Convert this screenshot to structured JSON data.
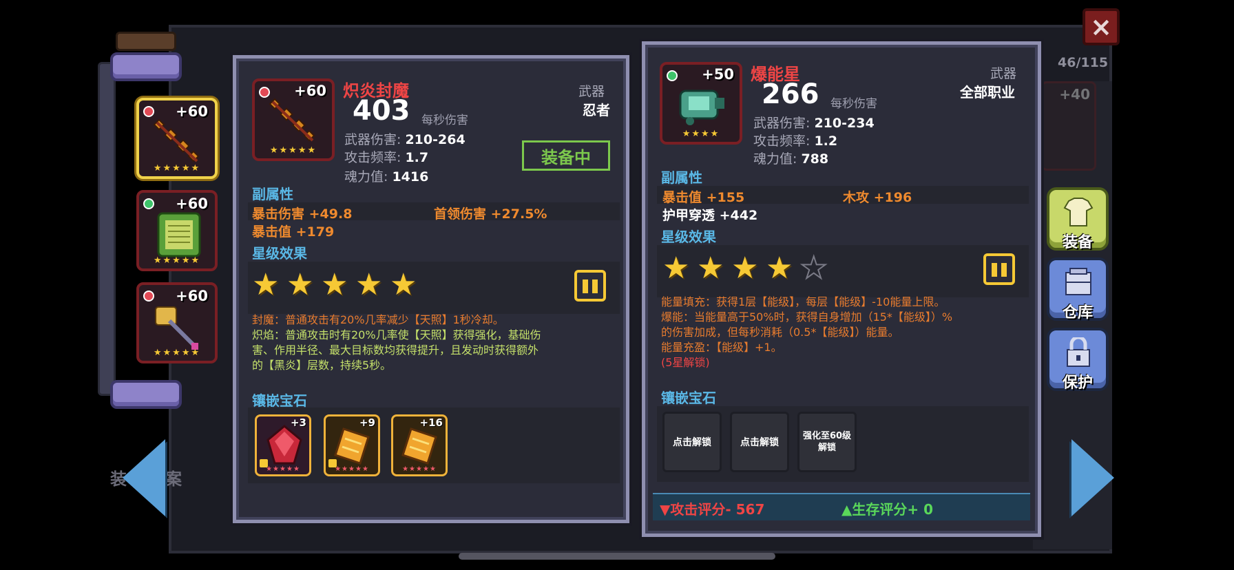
{
  "counter": "46/115",
  "close_icon": "×",
  "ghost_left": "装",
  "ghost_left2": "案",
  "list_items": [
    {
      "plus": "+60",
      "stars": "★★★★★"
    },
    {
      "plus": "+60",
      "stars": "★★★★★"
    },
    {
      "plus": "+60",
      "stars": "★★★★★"
    }
  ],
  "bg_item_plus": "+40",
  "left": {
    "plus": "+60",
    "stars": "★★★★★",
    "name": "炽炎封魔",
    "dps": "403",
    "dps_label": "每秒伤害",
    "type": "武器",
    "class": "忍者",
    "weapon_damage_label": "武器伤害:",
    "weapon_damage": "210-264",
    "attack_rate_label": "攻击频率:",
    "attack_rate": "1.7",
    "soul_label": "魂力值:",
    "soul": "1416",
    "equipped": "装备中",
    "sub_attr_title": "副属性",
    "sub_attrs": [
      "暴击伤害 +49.8",
      "首领伤害 +27.5%",
      "暴击值 +179"
    ],
    "star_title": "星级效果",
    "star_count": 5,
    "effect_1": "封魔：普通攻击有20%几率减少【天照】1秒冷却。",
    "effect_2": "炽焰：普通攻击时有20%几率使【天照】获得强化，基础伤",
    "effect_3": "害、作用半径、最大目标数均获得提升，且发动时获得额外",
    "effect_4": "的【黑炎】层数，持续5秒。",
    "gem_title": "镶嵌宝石",
    "gems": [
      {
        "level": "+3",
        "stars": "★★★★★"
      },
      {
        "level": "+9",
        "stars": "★★★★★"
      },
      {
        "level": "+16",
        "stars": "★★★★★"
      }
    ]
  },
  "right": {
    "plus": "+50",
    "stars": "★★★★",
    "name": "爆能星",
    "dps": "266",
    "dps_label": "每秒伤害",
    "type": "武器",
    "class": "全部职业",
    "weapon_damage_label": "武器伤害:",
    "weapon_damage": "210-234",
    "attack_rate_label": "攻击频率:",
    "attack_rate": "1.2",
    "soul_label": "魂力值:",
    "soul": "788",
    "sub_attr_title": "副属性",
    "sub_attrs": [
      "暴击值 +155",
      "木攻 +196",
      "护甲穿透 +442"
    ],
    "star_title": "星级效果",
    "star_count": 4,
    "star_max": 5,
    "effect_1": "能量填充：获得1层【能级】，每层【能级】-10能量上限。",
    "effect_2": "爆能：当能量高于50%时，获得自身增加（15*【能级】）%",
    "effect_3": "的伤害加成，但每秒消耗（0.5*【能级】）能量。",
    "effect_4": "能量充盈：【能级】+1。",
    "effect_5": "(5星解锁)",
    "gem_title": "镶嵌宝石",
    "gem_slots": [
      "点击解锁",
      "点击解锁",
      "强化至60级\n解锁"
    ],
    "score_attack": "▼攻击评分- 567",
    "score_survival": "▲生存评分+ 0"
  },
  "side_nav": [
    "装备",
    "仓库",
    "保护"
  ],
  "colors": {
    "panel_bg": "#2b2c39",
    "name_red": "#ef4545",
    "section_blue": "#5ab8e6",
    "attr_orange": "#ef8a2e",
    "equipped_green": "#7cc84c",
    "star_gold": "#f6c935"
  }
}
